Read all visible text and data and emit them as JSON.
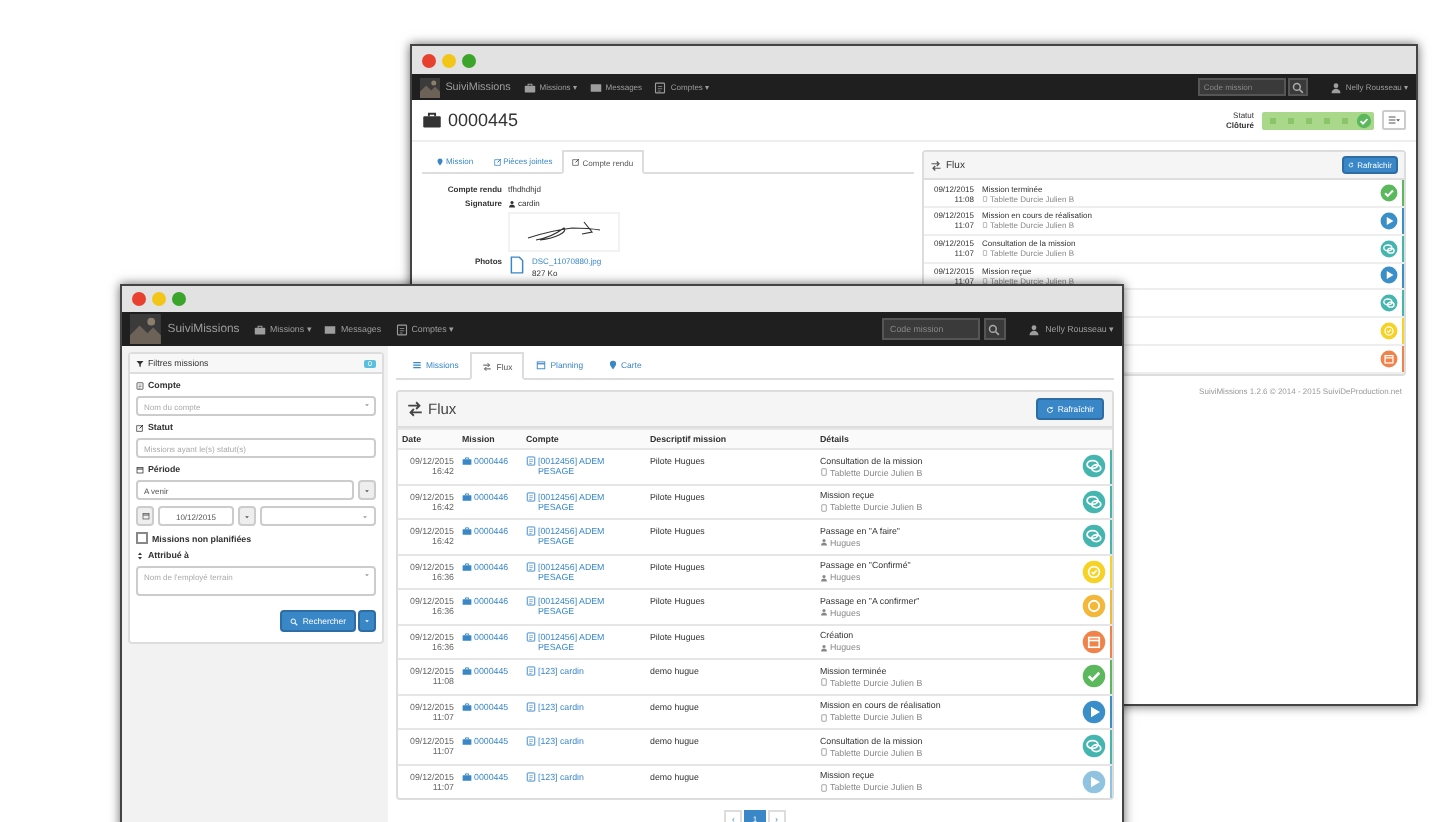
{
  "back_window": {
    "navbar": {
      "brand": "SuiviMissions",
      "menu": [
        "Missions ▾",
        "Messages",
        "Comptes ▾"
      ],
      "search": {
        "placeholder": "Code mission"
      },
      "user": "Nelly Rousseau ▾"
    },
    "title": "0000445",
    "status": {
      "label": "Statut",
      "value": "Clôturé"
    },
    "tabs": [
      {
        "label": "Mission",
        "selected": false
      },
      {
        "label": "Pièces jointes",
        "selected": false
      },
      {
        "label": "Compte rendu",
        "selected": true
      }
    ],
    "report": {
      "fields": [
        {
          "label": "Compte rendu",
          "value": "tfhdhdhjd"
        },
        {
          "label": "Signature",
          "value": "cardin"
        }
      ],
      "photos": {
        "label": "Photos",
        "file": "DSC_11070880.jpg",
        "size": "827 Ko"
      }
    },
    "flux": {
      "title": "Flux",
      "refresh": "Rafraîchir",
      "items": [
        {
          "date": "09/12/2015",
          "time": "11:08",
          "title": "Mission terminée",
          "detail": "Tablette Durcie Julien B",
          "kind": "done",
          "color": "#5cb85c"
        },
        {
          "date": "09/12/2015",
          "time": "11:07",
          "title": "Mission en cours de réalisation",
          "detail": "Tablette Durcie Julien B",
          "kind": "play",
          "color": "#3a8fc8"
        },
        {
          "date": "09/12/2015",
          "time": "11:07",
          "title": "Consultation de la mission",
          "detail": "Tablette Durcie Julien B",
          "kind": "chat",
          "color": "#45b5b0"
        },
        {
          "date": "09/12/2015",
          "time": "11:07",
          "title": "Mission reçue",
          "detail": "Tablette Durcie Julien B",
          "kind": "play",
          "color": "#3a8fc8"
        },
        {
          "kind": "chat",
          "color": "#45b5b0"
        },
        {
          "kind": "confirmed",
          "color": "#f5d224"
        },
        {
          "kind": "created",
          "color": "#f0834a"
        }
      ]
    },
    "footer": "SuiviMissions 1.2.6 © 2014 - 2015 SuiviDeProduction.net"
  },
  "front_window": {
    "navbar": {
      "brand": "SuiviMissions",
      "menu": [
        "Missions ▾",
        "Messages",
        "Comptes ▾"
      ],
      "search": {
        "placeholder": "Code mission"
      },
      "user": "Nelly Rousseau ▾"
    },
    "filters": {
      "title": "Filtres missions",
      "badge": "0",
      "account": {
        "label": "Compte",
        "placeholder": "Nom du compte"
      },
      "status": {
        "label": "Statut",
        "placeholder": "Missions ayant le(s) statut(s)"
      },
      "period": {
        "label": "Période",
        "value": "A venir",
        "date": "10/12/2015"
      },
      "unplanned": {
        "label": "Missions non planifiées",
        "checked": false
      },
      "assignee": {
        "label": "Attribué à",
        "placeholder": "Nom de l'employé terrain"
      },
      "search_button": "Rechercher"
    },
    "tabs": [
      {
        "label": "Missions",
        "selected": false
      },
      {
        "label": "Flux",
        "selected": true
      },
      {
        "label": "Planning",
        "selected": false
      },
      {
        "label": "Carte",
        "selected": false
      }
    ],
    "flux": {
      "title": "Flux",
      "refresh": "Rafraîchir",
      "columns": [
        "Date",
        "Mission",
        "Compte",
        "Descriptif mission",
        "Détails"
      ],
      "rows": [
        {
          "date": "09/12/2015",
          "time": "16:42",
          "mission": "0000446",
          "account": "[0012456] ADEM PESAGE",
          "description": "Pilote Hugues",
          "title": "Consultation de la mission",
          "detail": {
            "kind": "device",
            "text": "Tablette Durcie Julien B"
          },
          "kind": "chat",
          "color": "#45b5b0"
        },
        {
          "date": "09/12/2015",
          "time": "16:42",
          "mission": "0000446",
          "account": "[0012456] ADEM PESAGE",
          "description": "Pilote Hugues",
          "title": "Mission reçue",
          "detail": {
            "kind": "device",
            "text": "Tablette Durcie Julien B"
          },
          "kind": "chat",
          "color": "#45b5b0"
        },
        {
          "date": "09/12/2015",
          "time": "16:42",
          "mission": "0000446",
          "account": "[0012456] ADEM PESAGE",
          "description": "Pilote Hugues",
          "title": "Passage en \"A faire\"",
          "detail": {
            "kind": "user",
            "text": "Hugues"
          },
          "kind": "chat",
          "color": "#45b5b0"
        },
        {
          "date": "09/12/2015",
          "time": "16:36",
          "mission": "0000446",
          "account": "[0012456] ADEM PESAGE",
          "description": "Pilote Hugues",
          "title": "Passage en \"Confirmé\"",
          "detail": {
            "kind": "user",
            "text": "Hugues"
          },
          "kind": "confirmed",
          "color": "#f5d224"
        },
        {
          "date": "09/12/2015",
          "time": "16:36",
          "mission": "0000446",
          "account": "[0012456] ADEM PESAGE",
          "description": "Pilote Hugues",
          "title": "Passage en \"A confirmer\"",
          "detail": {
            "kind": "user",
            "text": "Hugues"
          },
          "kind": "pending",
          "color": "#f3b73a"
        },
        {
          "date": "09/12/2015",
          "time": "16:36",
          "mission": "0000446",
          "account": "[0012456] ADEM PESAGE",
          "description": "Pilote Hugues",
          "title": "Création",
          "detail": {
            "kind": "user",
            "text": "Hugues"
          },
          "kind": "created",
          "color": "#f0834a"
        },
        {
          "date": "09/12/2015",
          "time": "11:08",
          "mission": "0000445",
          "account": "[123] cardin",
          "description": "demo hugue",
          "title": "Mission terminée",
          "detail": {
            "kind": "device",
            "text": "Tablette Durcie Julien B"
          },
          "kind": "done",
          "color": "#5cb85c"
        },
        {
          "date": "09/12/2015",
          "time": "11:07",
          "mission": "0000445",
          "account": "[123] cardin",
          "description": "demo hugue",
          "title": "Mission en cours de réalisation",
          "detail": {
            "kind": "device",
            "text": "Tablette Durcie Julien B"
          },
          "kind": "play",
          "color": "#3a8fc8"
        },
        {
          "date": "09/12/2015",
          "time": "11:07",
          "mission": "0000445",
          "account": "[123] cardin",
          "description": "demo hugue",
          "title": "Consultation de la mission",
          "detail": {
            "kind": "device",
            "text": "Tablette Durcie Julien B"
          },
          "kind": "chat",
          "color": "#45b5b0"
        },
        {
          "date": "09/12/2015",
          "time": "11:07",
          "mission": "0000445",
          "account": "[123] cardin",
          "description": "demo hugue",
          "title": "Mission reçue",
          "detail": {
            "kind": "device",
            "text": "Tablette Durcie Julien B"
          },
          "kind": "play",
          "color": "#8fc3e0"
        }
      ]
    },
    "pagination": [
      {
        "label": "‹",
        "selected": false
      },
      {
        "label": "1",
        "selected": true
      },
      {
        "label": "›",
        "selected": false
      }
    ]
  }
}
